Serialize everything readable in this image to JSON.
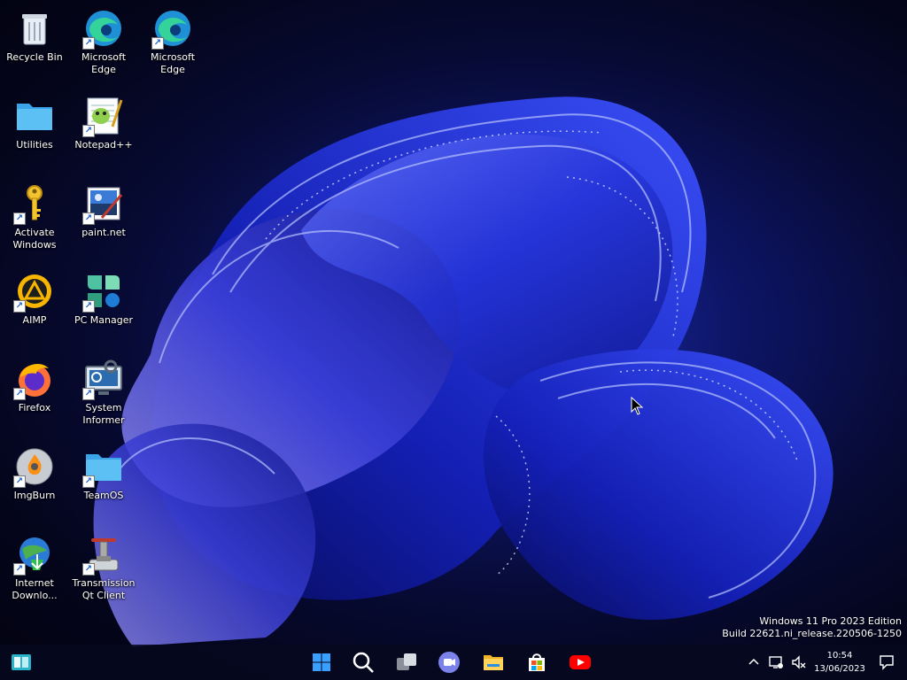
{
  "desktop": {
    "icons": [
      {
        "label": "Recycle Bin",
        "icon": "recycle-bin-icon",
        "shortcut": false
      },
      {
        "label": "Microsoft Edge",
        "icon": "edge-icon",
        "shortcut": true
      },
      {
        "label": "Microsoft Edge",
        "icon": "edge-icon",
        "shortcut": true
      },
      {
        "label": "Utilities",
        "icon": "folder-icon",
        "shortcut": false
      },
      {
        "label": "Notepad++",
        "icon": "notepad-plus-plus-icon",
        "shortcut": true
      },
      {
        "label": "Activate Windows",
        "icon": "key-icon",
        "shortcut": true
      },
      {
        "label": "paint.net",
        "icon": "paint-net-icon",
        "shortcut": true
      },
      {
        "label": "AIMP",
        "icon": "aimp-icon",
        "shortcut": true
      },
      {
        "label": "PC Manager",
        "icon": "pc-manager-icon",
        "shortcut": true
      },
      {
        "label": "Firefox",
        "icon": "firefox-icon",
        "shortcut": true
      },
      {
        "label": "System Informer",
        "icon": "system-informer-icon",
        "shortcut": true
      },
      {
        "label": "ImgBurn",
        "icon": "imgburn-icon",
        "shortcut": true
      },
      {
        "label": "TeamOS",
        "icon": "folder-icon",
        "shortcut": true
      },
      {
        "label": "Internet Downlo...",
        "icon": "idm-icon",
        "shortcut": true
      },
      {
        "label": "Transmission Qt Client",
        "icon": "transmission-icon",
        "shortcut": true
      }
    ]
  },
  "watermark": {
    "line1": "Windows 11 Pro 2023 Edition",
    "line2": "Build 22621.ni_release.220506-1250"
  },
  "taskbar": {
    "left": {
      "icon": "widgets-icon"
    },
    "center": [
      {
        "name": "start",
        "icon": "windows-logo-icon"
      },
      {
        "name": "search",
        "icon": "search-icon"
      },
      {
        "name": "task-view",
        "icon": "task-view-icon"
      },
      {
        "name": "meet",
        "icon": "video-chat-icon"
      },
      {
        "name": "file-explorer",
        "icon": "folder-icon"
      },
      {
        "name": "store",
        "icon": "store-icon"
      },
      {
        "name": "youtube",
        "icon": "youtube-icon"
      }
    ],
    "tray": {
      "chevron_icon": "chevron-up-icon",
      "network_icon": "network-icon",
      "volume_icon": "volume-muted-icon",
      "time": "10:54",
      "date": "13/06/2023",
      "notification_icon": "notification-icon"
    }
  },
  "colors": {
    "accent": "#1a5fd0",
    "wallpaper_bloom": "#2f4cff",
    "youtube": "#ff0000"
  }
}
